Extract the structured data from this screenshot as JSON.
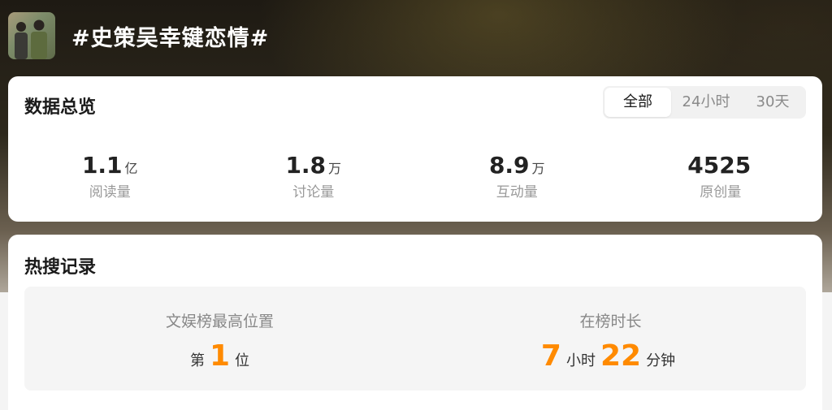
{
  "header": {
    "topic_title": "#史策吴幸键恋情#"
  },
  "overview": {
    "title": "数据总览",
    "tabs": [
      {
        "label": "全部",
        "active": true
      },
      {
        "label": "24小时",
        "active": false
      },
      {
        "label": "30天",
        "active": false
      }
    ],
    "stats": [
      {
        "value": "1.1",
        "unit": "亿",
        "label": "阅读量"
      },
      {
        "value": "1.8",
        "unit": "万",
        "label": "讨论量"
      },
      {
        "value": "8.9",
        "unit": "万",
        "label": "互动量"
      },
      {
        "value": "4525",
        "unit": "",
        "label": "原创量"
      }
    ]
  },
  "hot_search": {
    "title": "热搜记录",
    "best_rank": {
      "label": "文娱榜最高位置",
      "prefix": "第",
      "value": "1",
      "suffix": "位"
    },
    "duration": {
      "label": "在榜时长",
      "hours": "7",
      "hours_unit": "小时",
      "minutes": "22",
      "minutes_unit": "分钟"
    }
  },
  "colors": {
    "accent_orange": "#ff8a00",
    "card_bg": "#ffffff",
    "panel_bg": "#f5f5f5"
  }
}
